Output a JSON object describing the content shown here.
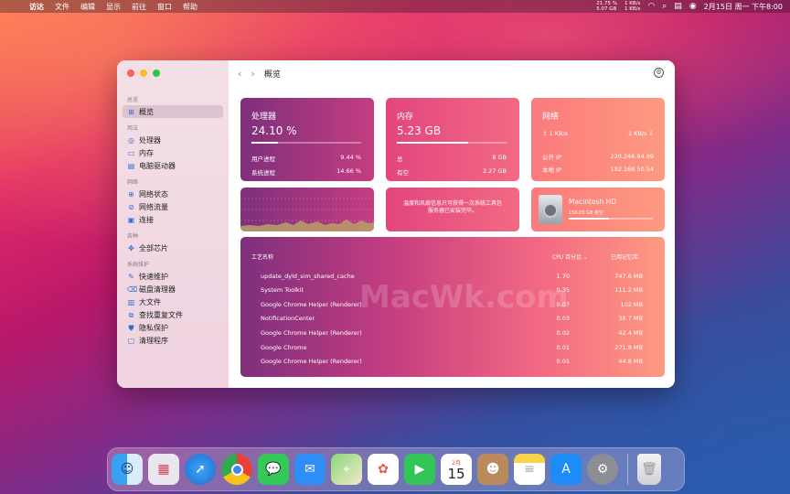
{
  "menubar": {
    "apple": "",
    "items": [
      "访达",
      "文件",
      "编辑",
      "显示",
      "前往",
      "窗口",
      "帮助"
    ],
    "cpu_pct": "21.75 %",
    "mem_gb": "5.07 GB",
    "net_up": "1 KB/s",
    "net_down": "1 KB/s",
    "datetime": "2月15日 周一 下午8:00"
  },
  "sidebar": {
    "sections": [
      {
        "title": "总览",
        "items": [
          {
            "label": "概览",
            "icon": "grid-icon",
            "selected": true
          }
        ]
      },
      {
        "title": "用法",
        "items": [
          {
            "label": "处理器",
            "icon": "cpu-icon"
          },
          {
            "label": "内存",
            "icon": "memory-icon"
          },
          {
            "label": "电脑驱动器",
            "icon": "drive-icon"
          }
        ]
      },
      {
        "title": "网络",
        "items": [
          {
            "label": "网络状态",
            "icon": "globe-icon"
          },
          {
            "label": "网络流量",
            "icon": "traffic-icon"
          },
          {
            "label": "连接",
            "icon": "monitor-icon"
          }
        ]
      },
      {
        "title": "各种",
        "items": [
          {
            "label": "全部芯片",
            "icon": "chip-icon"
          }
        ]
      },
      {
        "title": "系统维护",
        "items": [
          {
            "label": "快速维护",
            "icon": "wrench-icon"
          },
          {
            "label": "磁盘清理器",
            "icon": "broom-icon"
          },
          {
            "label": "大文件",
            "icon": "file-icon"
          },
          {
            "label": "查找重复文件",
            "icon": "duplicate-icon"
          },
          {
            "label": "隐私保护",
            "icon": "shield-icon"
          },
          {
            "label": "清理程序",
            "icon": "app-icon"
          }
        ]
      }
    ]
  },
  "toolbar": {
    "back": "‹",
    "forward": "›",
    "title": "概览"
  },
  "cpu": {
    "title": "处理器",
    "value": "24.10 %",
    "progress": 0.241,
    "user_label": "用户进程",
    "user_value": "9.44 %",
    "sys_label": "系统进程",
    "sys_value": "14.66 %"
  },
  "memory": {
    "title": "内存",
    "value": "5.23 GB",
    "progress": 0.65,
    "total_label": "总",
    "total_value": "8 GB",
    "free_label": "有空",
    "free_value": "2.27 GB"
  },
  "network": {
    "title": "网络",
    "up": "1 KB/s",
    "down": "1 KB/s",
    "public_label": "公开 IP",
    "public_value": "220.246.94.89",
    "local_label": "本地 IP",
    "local_value": "192.168.50.54"
  },
  "notice": {
    "line1": "温度和风扇信息只可获得一次系统工具包",
    "line2": "服务器已安装完毕。"
  },
  "disk": {
    "name": "Macintosh HD",
    "size": "150.03 GB 有空",
    "progress": 0.48
  },
  "processes": {
    "col_name": "工艺名称",
    "col_cpu": "CPU 百分比",
    "col_mem": "已用记忆库",
    "rows": [
      {
        "name": "update_dyld_sim_shared_cache",
        "cpu": "1.70",
        "mem": "747.6 MB"
      },
      {
        "name": "System Toolkit",
        "cpu": "0.35",
        "mem": "111.2 MB"
      },
      {
        "name": "Google Chrome Helper (Renderer)",
        "cpu": "0.07",
        "mem": "102 MB"
      },
      {
        "name": "NotificationCenter",
        "cpu": "0.03",
        "mem": "38.7 MB"
      },
      {
        "name": "Google Chrome Helper (Renderer)",
        "cpu": "0.02",
        "mem": "42.4 MB"
      },
      {
        "name": "Google Chrome",
        "cpu": "0.01",
        "mem": "271.8 MB"
      },
      {
        "name": "Google Chrome Helper (Renderer)",
        "cpu": "0.01",
        "mem": "44.8 MB"
      }
    ]
  },
  "watermark": "MacWk.com",
  "dock": {
    "calendar_month": "2月",
    "calendar_day": "15",
    "apps": [
      "finder-icon",
      "launchpad-icon",
      "safari-icon",
      "chrome-icon",
      "messages-icon",
      "mail-icon",
      "maps-icon",
      "photos-icon",
      "facetime-icon",
      "calendar-icon",
      "contacts-icon",
      "notes-icon",
      "appstore-icon",
      "settings-icon",
      "trash-icon"
    ]
  }
}
